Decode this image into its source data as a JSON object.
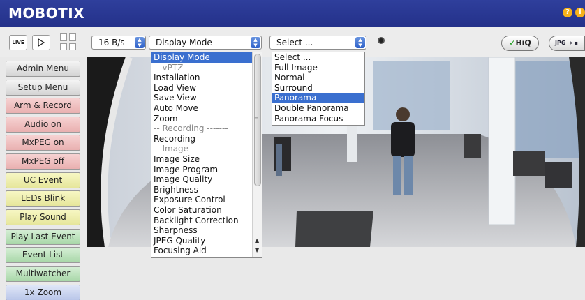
{
  "header": {
    "brand": "MOBOTIX",
    "help_icons": [
      "?",
      "i"
    ]
  },
  "toolbar": {
    "live_label": "LIVE",
    "frame_rate": "16 B/s",
    "display_mode": "Display Mode",
    "view_select": "Select ...",
    "hiq_label": "HiQ",
    "jpg_label": "JPG"
  },
  "sidebar": {
    "buttons": [
      {
        "label": "Admin Menu",
        "color": "grey"
      },
      {
        "label": "Setup Menu",
        "color": "grey"
      },
      {
        "label": "Arm & Record",
        "color": "pink"
      },
      {
        "label": "Audio on",
        "color": "pink"
      },
      {
        "label": "MxPEG on",
        "color": "pink"
      },
      {
        "label": "MxPEG off",
        "color": "pink"
      },
      {
        "label": "UC Event",
        "color": "yellow"
      },
      {
        "label": "LEDs Blink",
        "color": "yellow"
      },
      {
        "label": "Play Sound",
        "color": "yellow"
      },
      {
        "label": "Play Last Event",
        "color": "green"
      },
      {
        "label": "Event List",
        "color": "green"
      },
      {
        "label": "Multiwatcher",
        "color": "green"
      },
      {
        "label": "1x Zoom",
        "color": "blue"
      }
    ]
  },
  "display_mode_menu": {
    "items": [
      "Display Mode",
      "-- vPTZ -----------",
      "Installation",
      "Load View",
      "Save View",
      "Auto Move",
      "Zoom",
      "-- Recording -------",
      "Recording",
      "-- Image ----------",
      "Image Size",
      "Image Program",
      "Image Quality",
      "Brightness",
      "Exposure Control",
      "Color Saturation",
      "Backlight Correction",
      "Sharpness",
      "JPEG Quality",
      "Focusing Aid"
    ],
    "selected_index": 0
  },
  "view_menu": {
    "items": [
      "Select ...",
      "Full Image",
      "Normal",
      "Surround",
      "Panorama",
      "Double Panorama",
      "Panorama Focus"
    ],
    "selected_index": 4
  },
  "colors": {
    "header": "#2a379a",
    "selection": "#3a6fcf",
    "accent_icon": "#f6b21a"
  }
}
